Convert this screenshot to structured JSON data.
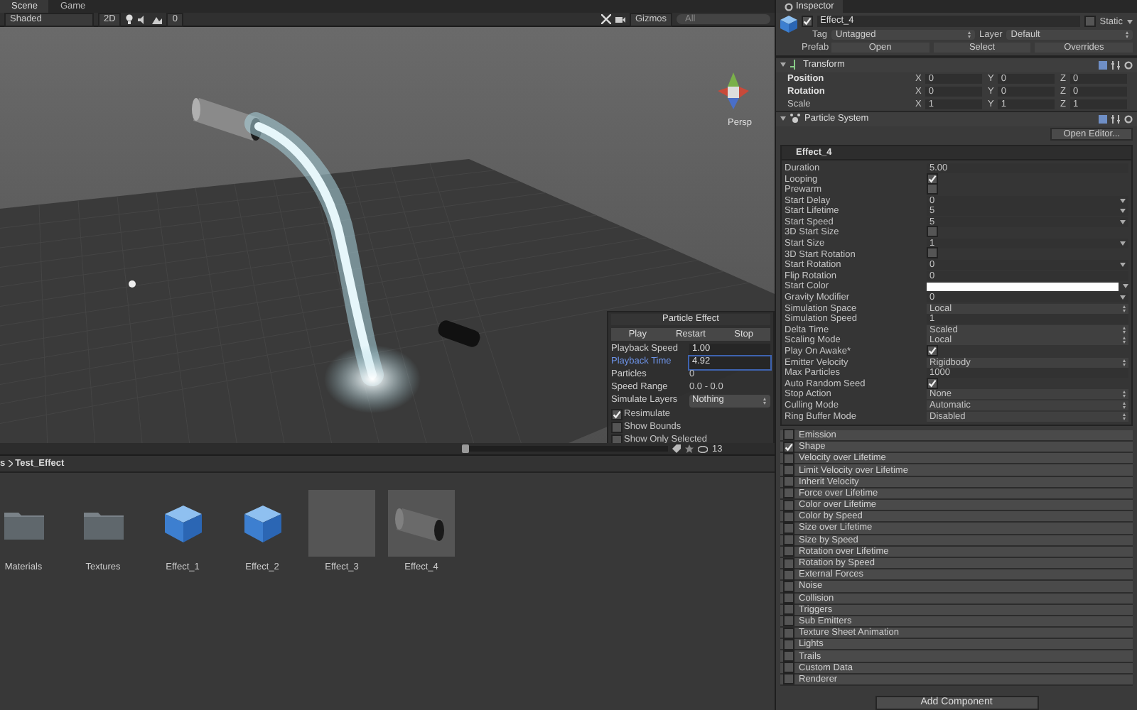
{
  "scene_tabs": [
    {
      "label": "Scene",
      "selected": true
    },
    {
      "label": "Game",
      "selected": false
    }
  ],
  "scene_toolbar": {
    "shading": "Shaded",
    "mode_2d": "2D",
    "effects_count": "0",
    "gizmos": "Gizmos",
    "search_placeholder": "All"
  },
  "viewport": {
    "projection": "Persp"
  },
  "particle_effect": {
    "title": "Particle Effect",
    "buttons": [
      "Play",
      "Restart",
      "Stop"
    ],
    "rows": [
      {
        "label": "Playback Speed",
        "value": "1.00",
        "kind": "field",
        "focused": false
      },
      {
        "label": "Playback Time",
        "value": "4.92",
        "kind": "field",
        "focused": true
      },
      {
        "label": "Particles",
        "value": "0",
        "kind": "text",
        "focused": false
      },
      {
        "label": "Speed Range",
        "value": "0.0 - 0.0",
        "kind": "text",
        "focused": false
      },
      {
        "label": "Simulate Layers",
        "value": "Nothing",
        "kind": "dropdown",
        "focused": false
      }
    ],
    "options": [
      {
        "label": "Resimulate",
        "checked": true
      },
      {
        "label": "Show Bounds",
        "checked": false
      },
      {
        "label": "Show Only Selected",
        "checked": false
      }
    ]
  },
  "project": {
    "zoom_slider": {
      "level": 0
    },
    "icon_count": "13",
    "breadcrumb": [
      "s",
      "Test_Effect"
    ],
    "assets": [
      {
        "name": "Materials",
        "kind": "folder"
      },
      {
        "name": "Textures",
        "kind": "folder"
      },
      {
        "name": "Effect_1",
        "kind": "prefab"
      },
      {
        "name": "Effect_2",
        "kind": "prefab"
      },
      {
        "name": "Effect_3",
        "kind": "empty"
      },
      {
        "name": "Effect_4",
        "kind": "cylinder"
      }
    ]
  },
  "inspector": {
    "tab": "Inspector",
    "object": {
      "name": "Effect_4",
      "active": true,
      "static_label": "Static",
      "static": false,
      "tag_label": "Tag",
      "tag": "Untagged",
      "layer_label": "Layer",
      "layer": "Default",
      "prefab_label": "Prefab",
      "prefab_buttons": [
        "Open",
        "Select",
        "Overrides"
      ]
    },
    "transform": {
      "title": "Transform",
      "rows": [
        {
          "label": "Position",
          "overridden": true,
          "values": [
            {
              "axis": "X",
              "value": "0"
            },
            {
              "axis": "Y",
              "value": "0"
            },
            {
              "axis": "Z",
              "value": "0"
            }
          ]
        },
        {
          "label": "Rotation",
          "overridden": true,
          "values": [
            {
              "axis": "X",
              "value": "0"
            },
            {
              "axis": "Y",
              "value": "0"
            },
            {
              "axis": "Z",
              "value": "0"
            }
          ]
        },
        {
          "label": "Scale",
          "overridden": false,
          "values": [
            {
              "axis": "X",
              "value": "1"
            },
            {
              "axis": "Y",
              "value": "1"
            },
            {
              "axis": "Z",
              "value": "1"
            }
          ]
        }
      ]
    },
    "particle_system": {
      "title": "Particle System",
      "open_editor": "Open Editor...",
      "section": "Effect_4",
      "properties": [
        {
          "label": "Duration",
          "kind": "value",
          "value": "5.00"
        },
        {
          "label": "Looping",
          "kind": "check",
          "checked": true
        },
        {
          "label": "Prewarm",
          "kind": "check",
          "checked": false
        },
        {
          "label": "Start Delay",
          "kind": "curve",
          "value": "0"
        },
        {
          "label": "Start Lifetime",
          "kind": "curve",
          "value": "5"
        },
        {
          "label": "Start Speed",
          "kind": "curve",
          "value": "5"
        },
        {
          "label": "3D Start Size",
          "kind": "check",
          "checked": false
        },
        {
          "label": "Start Size",
          "kind": "curve",
          "value": "1"
        },
        {
          "label": "3D Start Rotation",
          "kind": "check",
          "checked": false
        },
        {
          "label": "Start Rotation",
          "kind": "curve",
          "value": "0"
        },
        {
          "label": "Flip Rotation",
          "kind": "value",
          "value": "0"
        },
        {
          "label": "Start Color",
          "kind": "color",
          "color": "#ffffff"
        },
        {
          "label": "Gravity Modifier",
          "kind": "curve",
          "value": "0"
        },
        {
          "label": "Simulation Space",
          "kind": "dropdown",
          "value": "Local"
        },
        {
          "label": "Simulation Speed",
          "kind": "value",
          "value": "1"
        },
        {
          "label": "Delta Time",
          "kind": "dropdown",
          "value": "Scaled"
        },
        {
          "label": "Scaling Mode",
          "kind": "dropdown",
          "value": "Local"
        },
        {
          "label": "Play On Awake*",
          "kind": "check",
          "checked": true
        },
        {
          "label": "Emitter Velocity",
          "kind": "dropdown",
          "value": "Rigidbody"
        },
        {
          "label": "Max Particles",
          "kind": "value",
          "value": "1000"
        },
        {
          "label": "Auto Random Seed",
          "kind": "check",
          "checked": true
        },
        {
          "label": "Stop Action",
          "kind": "dropdown",
          "value": "None"
        },
        {
          "label": "Culling Mode",
          "kind": "dropdown",
          "value": "Automatic"
        },
        {
          "label": "Ring Buffer Mode",
          "kind": "dropdown",
          "value": "Disabled"
        }
      ],
      "modules": [
        {
          "label": "Emission",
          "checked": false
        },
        {
          "label": "Shape",
          "checked": true
        },
        {
          "label": "Velocity over Lifetime",
          "checked": false
        },
        {
          "label": "Limit Velocity over Lifetime",
          "checked": false
        },
        {
          "label": "Inherit Velocity",
          "checked": false
        },
        {
          "label": "Force over Lifetime",
          "checked": false
        },
        {
          "label": "Color over Lifetime",
          "checked": false
        },
        {
          "label": "Color by Speed",
          "checked": false
        },
        {
          "label": "Size over Lifetime",
          "checked": false
        },
        {
          "label": "Size by Speed",
          "checked": false
        },
        {
          "label": "Rotation over Lifetime",
          "checked": false
        },
        {
          "label": "Rotation by Speed",
          "checked": false
        },
        {
          "label": "External Forces",
          "checked": false
        },
        {
          "label": "Noise",
          "checked": false
        },
        {
          "label": "Collision",
          "checked": false
        },
        {
          "label": "Triggers",
          "checked": false
        },
        {
          "label": "Sub Emitters",
          "checked": false
        },
        {
          "label": "Texture Sheet Animation",
          "checked": false
        },
        {
          "label": "Lights",
          "checked": false
        },
        {
          "label": "Trails",
          "checked": false
        },
        {
          "label": "Custom Data",
          "checked": false
        },
        {
          "label": "Renderer",
          "checked": false
        }
      ]
    },
    "add_component": "Add Component"
  }
}
